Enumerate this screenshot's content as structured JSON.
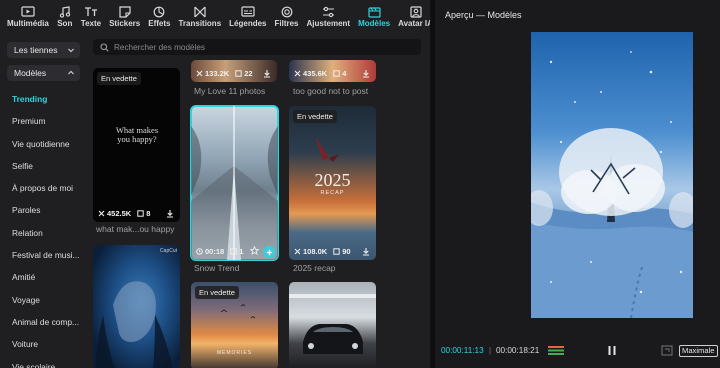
{
  "toolbar": {
    "items": [
      {
        "label": "Multimédia",
        "icon": "media-icon"
      },
      {
        "label": "Son",
        "icon": "music-icon"
      },
      {
        "label": "Texte",
        "icon": "text-icon"
      },
      {
        "label": "Stickers",
        "icon": "sticker-icon"
      },
      {
        "label": "Effets",
        "icon": "effects-icon"
      },
      {
        "label": "Transitions",
        "icon": "transition-icon"
      },
      {
        "label": "Légendes",
        "icon": "captions-icon"
      },
      {
        "label": "Filtres",
        "icon": "filter-icon"
      },
      {
        "label": "Ajustement",
        "icon": "adjust-icon"
      },
      {
        "label": "Modèles",
        "icon": "templates-icon",
        "active": true
      },
      {
        "label": "Avatar IA",
        "icon": "avatar-icon"
      }
    ]
  },
  "sidebar": {
    "scope_dropdown": "Les tiennes",
    "category_dropdown": "Modèles",
    "categories": [
      "Trending",
      "Premium",
      "Vie quotidienne",
      "Selfie",
      "À propos de moi",
      "Paroles",
      "Relation",
      "Festival de musi...",
      "Amitié",
      "Voyage",
      "Animal de comp...",
      "Voiture",
      "Vie scolaire"
    ],
    "active_category": "Trending"
  },
  "search": {
    "placeholder": "Rechercher des modèles"
  },
  "templates": {
    "top_mid": {
      "uses": "133.2K",
      "clips": "22",
      "caption": "My Love 11 photos"
    },
    "top_right": {
      "uses": "435.6K",
      "clips": "4",
      "caption": "too good not to post"
    },
    "what_makes": {
      "badge": "En vedette",
      "overlay_text": "What makes you happy?",
      "uses": "452.5K",
      "clips": "8",
      "caption": "what mak...ou happy"
    },
    "snow": {
      "duration": "00:18",
      "clips": "1",
      "caption": "Snow Trend"
    },
    "recap": {
      "badge": "En vedette",
      "overlay_year": "2025",
      "overlay_sub": "RECAP",
      "uses": "108.0K",
      "clips": "90",
      "caption": "2025 recap"
    },
    "rain": {
      "watermark": "CapCut"
    },
    "sunset": {
      "badge": "En vedette",
      "overlay_text": "MEMORIES"
    }
  },
  "preview": {
    "title": "Aperçu — Modèles",
    "current_time": "00:00:11:13",
    "total_time": "00:00:18:21",
    "fit_button": "Maximale"
  },
  "colors": {
    "accent": "#2fd3dc",
    "panel_bg": "#1f1f22",
    "preview_bg": "#1a1a1d"
  }
}
